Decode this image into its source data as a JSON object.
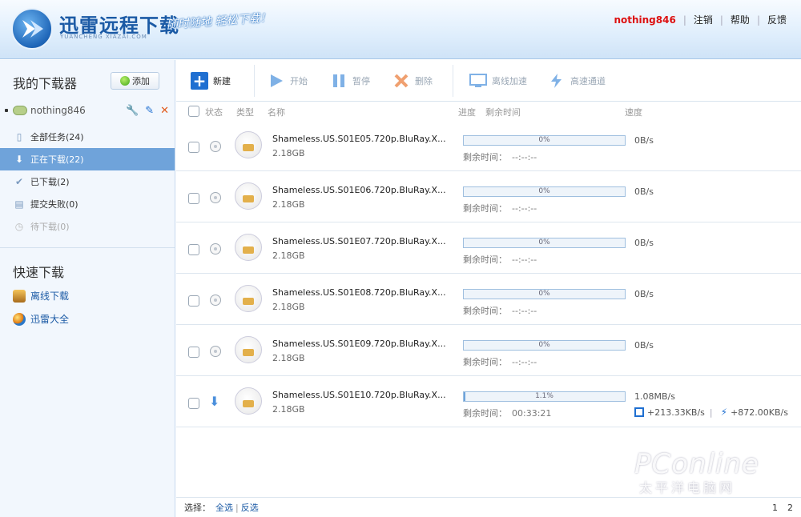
{
  "header": {
    "app_title": "迅雷远程下载",
    "app_subtitle": "YUANCHENG XIAZAI.COM",
    "slogan": "随时随地 轻松下载！",
    "username": "nothing846",
    "links": [
      "注销",
      "帮助",
      "反馈"
    ]
  },
  "sidebar": {
    "title": "我的下载器",
    "add_label": "添加",
    "device_name": "nothing846",
    "nav": [
      {
        "label": "全部任务(24)",
        "icon": "document-icon"
      },
      {
        "label": "正在下载(22)",
        "icon": "download-arrow-icon",
        "active": true
      },
      {
        "label": "已下载(2)",
        "icon": "checkmark-icon"
      },
      {
        "label": "提交失败(0)",
        "icon": "page-icon"
      },
      {
        "label": "待下载(0)",
        "icon": "clock-icon",
        "disabled": true
      }
    ],
    "quick_title": "快速下载",
    "quick": [
      {
        "label": "离线下载",
        "icon": "offline-download-icon"
      },
      {
        "label": "迅雷大全",
        "icon": "xunlei-globe-icon"
      }
    ]
  },
  "toolbar": {
    "new_label": "新建",
    "start_label": "开始",
    "pause_label": "暂停",
    "delete_label": "删除",
    "vip_label": "离线加速",
    "fast_label": "高速通道"
  },
  "columns": {
    "status": "状态",
    "type": "类型",
    "name": "名称",
    "progress": "进度",
    "remaining": "剩余时间",
    "speed": "速度"
  },
  "tasks": [
    {
      "name": "Shameless.US.S01E05.720p.BluRay.X...",
      "size": "2.18GB",
      "progress": "0%",
      "progress_value": 0,
      "remaining_label": "剩余时间：",
      "remaining": "--:--:--",
      "speed": "0B/s"
    },
    {
      "name": "Shameless.US.S01E06.720p.BluRay.X...",
      "size": "2.18GB",
      "progress": "0%",
      "progress_value": 0,
      "remaining_label": "剩余时间：",
      "remaining": "--:--:--",
      "speed": "0B/s"
    },
    {
      "name": "Shameless.US.S01E07.720p.BluRay.X...",
      "size": "2.18GB",
      "progress": "0%",
      "progress_value": 0,
      "remaining_label": "剩余时间：",
      "remaining": "--:--:--",
      "speed": "0B/s"
    },
    {
      "name": "Shameless.US.S01E08.720p.BluRay.X...",
      "size": "2.18GB",
      "progress": "0%",
      "progress_value": 0,
      "remaining_label": "剩余时间：",
      "remaining": "--:--:--",
      "speed": "0B/s"
    },
    {
      "name": "Shameless.US.S01E09.720p.BluRay.X...",
      "size": "2.18GB",
      "progress": "0%",
      "progress_value": 0,
      "remaining_label": "剩余时间：",
      "remaining": "--:--:--",
      "speed": "0B/s"
    },
    {
      "name": "Shameless.US.S01E10.720p.BluRay.X...",
      "size": "2.18GB",
      "progress": "1.1%",
      "progress_value": 1.1,
      "remaining_label": "剩余时间：",
      "remaining": "00:33:21",
      "speed": "1.08MB/s",
      "vip_speed": "+213.33KB/s",
      "fast_speed": "+872.00KB/s",
      "downloading": true
    }
  ],
  "footer": {
    "select_label": "选择：",
    "select_all": "全选",
    "invert": "反选",
    "pages": [
      "1",
      "2"
    ]
  },
  "watermark": {
    "brand": "PConline",
    "cn": "太平洋电脑网"
  }
}
